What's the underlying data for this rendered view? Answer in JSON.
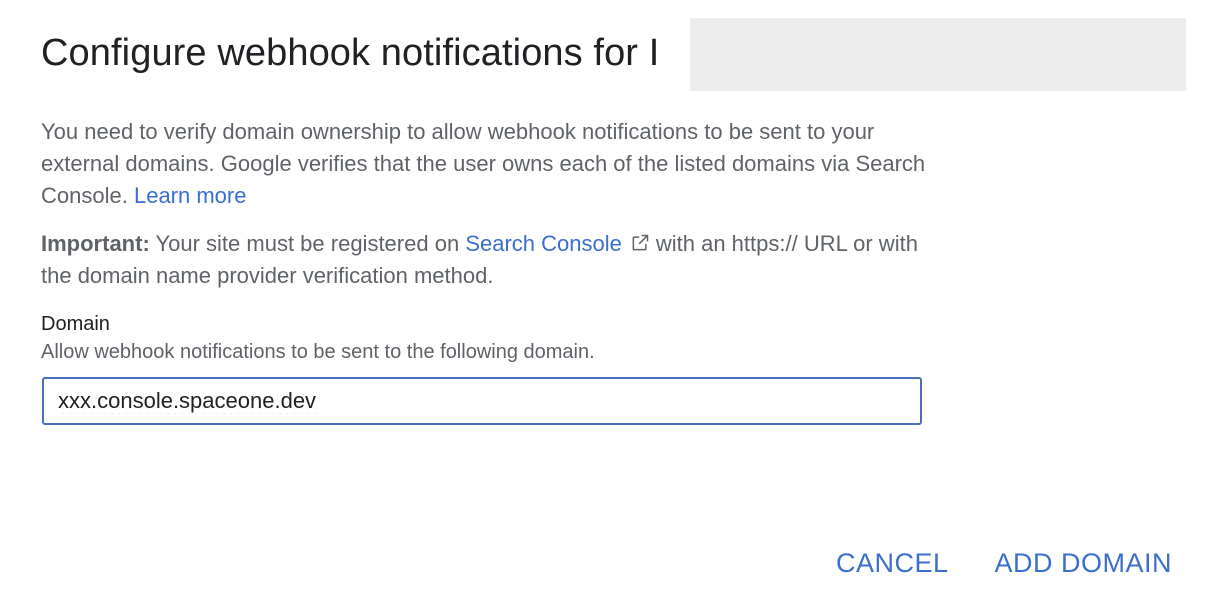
{
  "dialog": {
    "title": "Configure webhook notifications for I",
    "description": "You need to verify domain ownership to allow webhook notifications to be sent to your external domains. Google verifies that the user owns each of the listed domains via Search Console.",
    "learn_more_link": "Learn more",
    "important_label": "Important:",
    "important_text_before": "Your site must be registered on",
    "search_console_link": "Search Console",
    "external_icon": "external-link-icon",
    "important_text_after": "with an https:// URL or with the domain name provider verification method.",
    "field": {
      "label": "Domain",
      "hint": "Allow webhook notifications to be sent to the following domain.",
      "value": "xxx.console.spaceone.dev"
    },
    "buttons": {
      "cancel": "CANCEL",
      "add_domain": "ADD DOMAIN"
    }
  },
  "colors": {
    "link": "#3b6fce",
    "input_border": "#4a6fb8",
    "redaction": "#ececec"
  }
}
